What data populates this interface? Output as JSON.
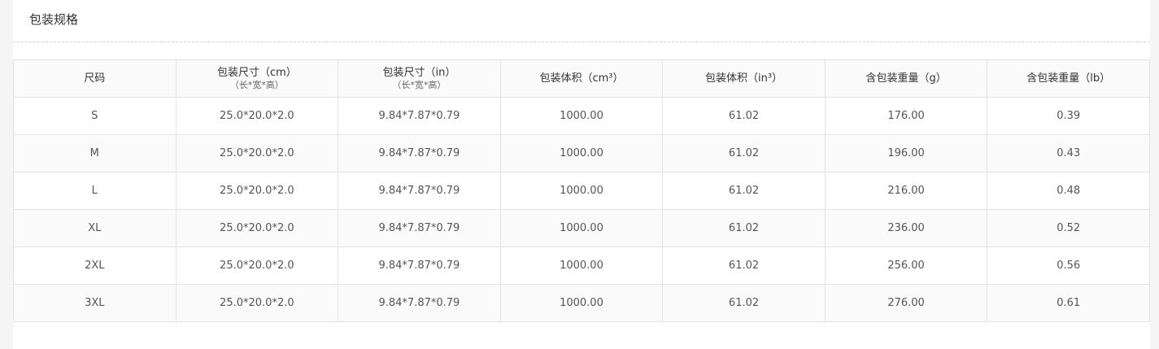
{
  "section": {
    "title": "包装规格"
  },
  "table": {
    "headers": [
      {
        "label": "尺码",
        "sub": ""
      },
      {
        "label": "包装尺寸（cm）",
        "sub": "（长*宽*高）"
      },
      {
        "label": "包装尺寸（in）",
        "sub": "（长*宽*高）"
      },
      {
        "label": "包装体积（cm³）",
        "sub": ""
      },
      {
        "label": "包装体积（in³）",
        "sub": ""
      },
      {
        "label": "含包装重量（g）",
        "sub": ""
      },
      {
        "label": "含包装重量（lb）",
        "sub": ""
      }
    ],
    "rows": [
      [
        "S",
        "25.0*20.0*2.0",
        "9.84*7.87*0.79",
        "1000.00",
        "61.02",
        "176.00",
        "0.39"
      ],
      [
        "M",
        "25.0*20.0*2.0",
        "9.84*7.87*0.79",
        "1000.00",
        "61.02",
        "196.00",
        "0.43"
      ],
      [
        "L",
        "25.0*20.0*2.0",
        "9.84*7.87*0.79",
        "1000.00",
        "61.02",
        "216.00",
        "0.48"
      ],
      [
        "XL",
        "25.0*20.0*2.0",
        "9.84*7.87*0.79",
        "1000.00",
        "61.02",
        "236.00",
        "0.52"
      ],
      [
        "2XL",
        "25.0*20.0*2.0",
        "9.84*7.87*0.79",
        "1000.00",
        "61.02",
        "256.00",
        "0.56"
      ],
      [
        "3XL",
        "25.0*20.0*2.0",
        "9.84*7.87*0.79",
        "1000.00",
        "61.02",
        "276.00",
        "0.61"
      ]
    ]
  }
}
